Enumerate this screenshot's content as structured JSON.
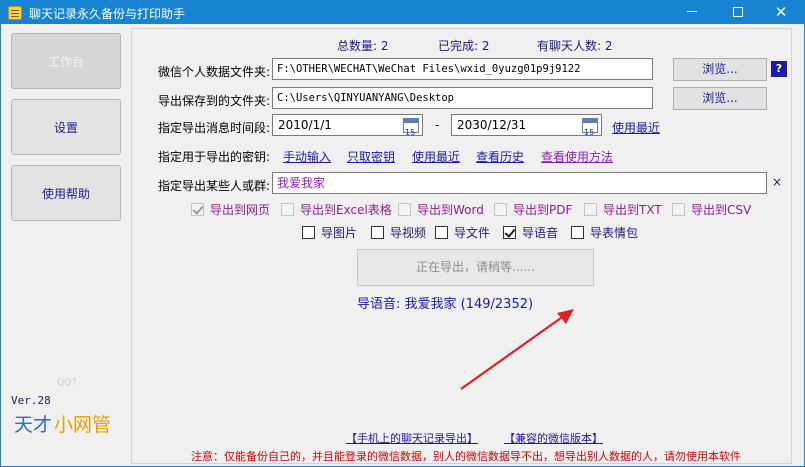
{
  "window": {
    "title": "聊天记录永久备份与打印助手"
  },
  "sidebar": {
    "work_label": "工作台",
    "settings_label": "设置",
    "help_label": "使用帮助",
    "version": "Ver.28",
    "qq_text": "QQ7",
    "logo_text_1": "天才",
    "logo_text_2": "小网管"
  },
  "stats": {
    "total": "总数量: 2",
    "done": "已完成: 2",
    "friends": "有聊天人数: 2"
  },
  "form": {
    "data_folder_label": "微信个人数据文件夹:",
    "data_folder_value": "F:\\OTHER\\WECHAT\\WeChat Files\\wxid_0yuzg01p9j9122",
    "output_folder_label": "导出保存到的文件夹:",
    "output_folder_value": "C:\\Users\\QINYUANYANG\\Desktop",
    "browse_label": "浏览...",
    "help_q": "?",
    "time_label": "指定导出消息时间段:",
    "date_start": "2010/1/1",
    "date_end": "2030/12/31",
    "date_dash": "-",
    "cal_day": "15",
    "use_recent_time": "使用最近",
    "key_label": "指定用于导出的密钥:",
    "key_manual": "手动输入",
    "key_fetch": "只取密钥",
    "key_recent": "使用最近",
    "key_history": "查看历史",
    "key_howto": "查看使用方法",
    "recipient_label": "指定导出某些人或群:",
    "recipient_value": "我爱我家",
    "clear_x": "×"
  },
  "exports": {
    "web": "导出到网页",
    "excel": "导出到Excel表格",
    "word": "导出到Word",
    "pdf": "导出到PDF",
    "txt": "导出到TXT",
    "csv": "导出到CSV"
  },
  "media": {
    "images": "导图片",
    "videos": "导视频",
    "files": "导文件",
    "voice": "导语音",
    "stickers": "导表情包"
  },
  "action": {
    "export_button": "正在导出，请稍等......",
    "progress": "导语音: 我爱我家 (149/2352)"
  },
  "footer": {
    "mobile_link": "【手机上的聊天记录导出】",
    "compat_link": "【兼容的微信版本】",
    "notice": "注意：仅能备份自己的，并且能登录的微信数据，别人的微信数据导不出，想导出别人数据的人，请勿使用本软件"
  },
  "colors": {
    "titlebar": "#1783d1",
    "link": "#1a1aa8",
    "annotation_arrow": "#e02020",
    "notice": "#d00000"
  }
}
